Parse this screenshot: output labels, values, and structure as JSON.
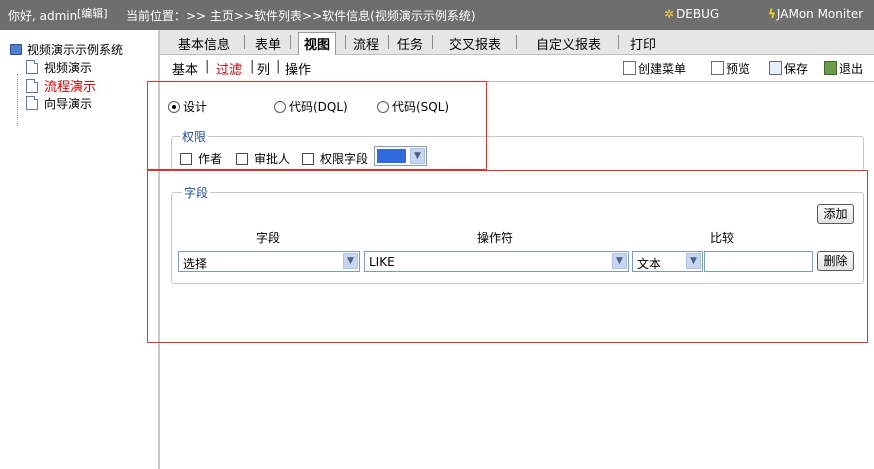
{
  "topbar": {
    "greeting": "你好, admin",
    "edit_label": "[编辑]",
    "location_prefix": "当前位置：",
    "location_path": ">> 主页>>软件列表>>软件信息(视频演示示例系统)",
    "debug_label": "DEBUG",
    "jamon_label": "JAMon Moniter"
  },
  "tree": {
    "root": "视频演示示例系统",
    "items": [
      {
        "label": "视频演示",
        "active": false
      },
      {
        "label": "流程演示",
        "active": true
      },
      {
        "label": "向导演示",
        "active": false
      }
    ]
  },
  "tabs": [
    "基本信息",
    "表单",
    "视图",
    "流程",
    "任务",
    "交叉报表",
    "自定义报表",
    "打印"
  ],
  "active_tab": "视图",
  "subtabs": [
    "基本",
    "过滤",
    "列",
    "操作"
  ],
  "active_subtab": "过滤",
  "toolbar": {
    "create_menu": "创建菜单",
    "preview": "预览",
    "save": "保存",
    "exit": "退出"
  },
  "mode": {
    "options": [
      "设计",
      "代码(DQL)",
      "代码(SQL)"
    ],
    "selected": "设计"
  },
  "permission": {
    "legend": "权限",
    "checkboxes": [
      "作者",
      "审批人",
      "权限字段"
    ],
    "color_value": "#2f6bdc"
  },
  "fields": {
    "legend": "字段",
    "add_button": "添加",
    "headers": {
      "field": "字段",
      "operator": "操作符",
      "compare": "比较"
    },
    "row": {
      "field_value": "选择",
      "operator_value": "LIKE",
      "compare_type": "文本",
      "compare_input": "",
      "delete_button": "删除"
    }
  },
  "colors": {
    "topbar_bg": "#6e6e6e",
    "legend_text": "#1f4e9c",
    "active_text": "#d80000",
    "annotation_red": "#e03030"
  }
}
